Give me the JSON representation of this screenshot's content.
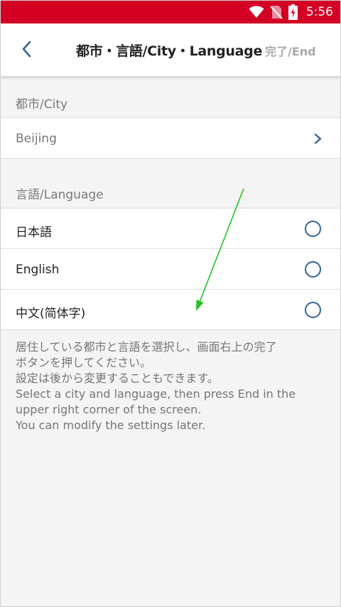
{
  "status_bar": {
    "time": "5:56",
    "icons": [
      "wifi-icon",
      "no-sim-icon",
      "battery-charging-icon"
    ],
    "background_color": "#d30024"
  },
  "header": {
    "back_icon": "chevron-left-icon",
    "title": "都市・言語/City・Language",
    "done_label": "完了/End"
  },
  "city_section": {
    "label": "都市/City",
    "selected_city": "Beijing",
    "chevron_icon": "chevron-right-icon"
  },
  "language_section": {
    "label": "言語/Language",
    "options": [
      {
        "label": "日本語",
        "selected": false
      },
      {
        "label": "English",
        "selected": false
      },
      {
        "label": "中文(简体字)",
        "selected": false
      }
    ]
  },
  "instructions": [
    "居住している都市と言語を選択し、画面右上の完了",
    "ボタンを押してください。",
    "設定は後から変更することもできます。",
    "Select a city and language, then press End in the",
    "upper right corner of the screen.",
    "You can modify the settings later."
  ],
  "colors": {
    "accent": "#35639a",
    "done_disabled": "#a9a9a9",
    "annotation_arrow": "#22c322"
  }
}
